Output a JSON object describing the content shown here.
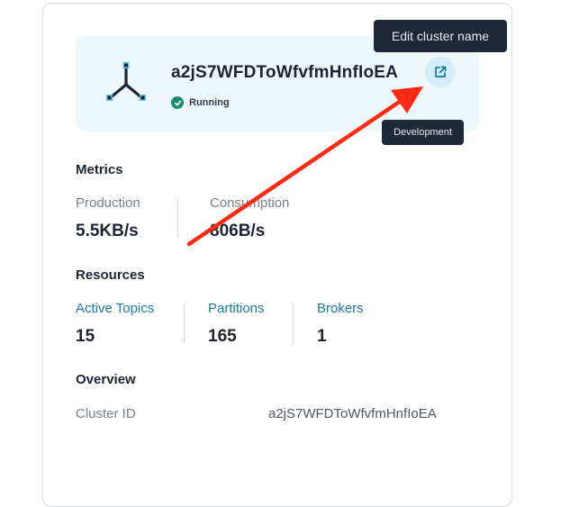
{
  "cluster": {
    "name": "a2jS7WFDToWfvfmHnfIoEA",
    "status": "Running",
    "environment_tag": "Development",
    "edit_tooltip": "Edit cluster name"
  },
  "metrics": {
    "title": "Metrics",
    "production_label": "Production",
    "production_value": "5.5KB/s",
    "consumption_label": "Consumption",
    "consumption_value": "806B/s"
  },
  "resources": {
    "title": "Resources",
    "items": [
      {
        "label": "Active Topics",
        "value": "15"
      },
      {
        "label": "Partitions",
        "value": "165"
      },
      {
        "label": "Brokers",
        "value": "1"
      }
    ]
  },
  "overview": {
    "title": "Overview",
    "cluster_id_label": "Cluster ID",
    "cluster_id_value": "a2jS7WFDToWfvfmHnfIoEA"
  },
  "colors": {
    "accent": "#1b7a9e",
    "status_green": "#1e8d6a",
    "annotation_arrow": "#ff2a12"
  },
  "icons": {
    "logo": "cluster-logo-icon",
    "edit": "external-edit-icon",
    "status": "check-circle-icon"
  }
}
